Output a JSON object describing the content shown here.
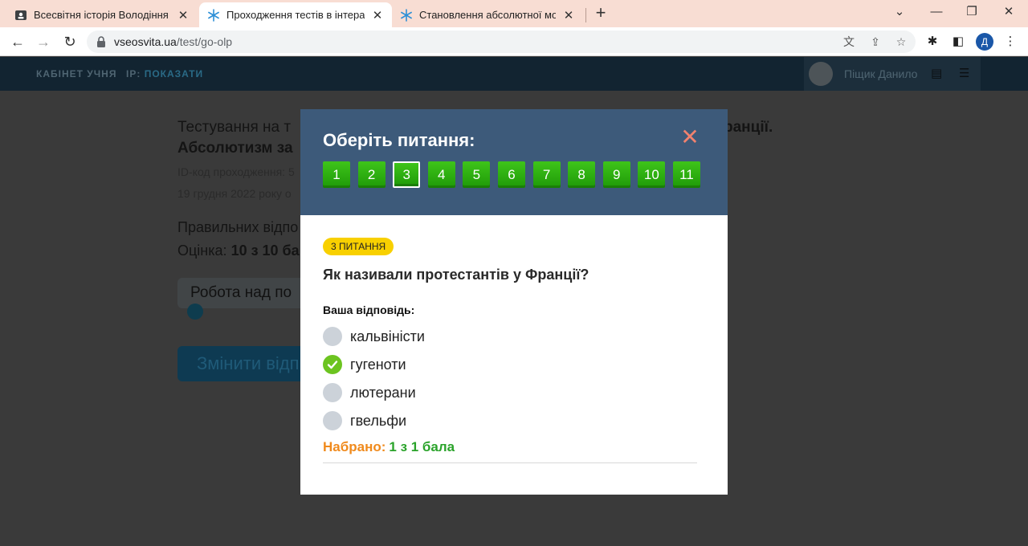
{
  "browser": {
    "tabs": [
      {
        "title": "Всесвітня історія Володіння Габ",
        "icon": "classroom-icon",
        "active": false
      },
      {
        "title": "Проходження тестів в інтеракти",
        "icon": "vseosvita-snowflake-icon",
        "active": true
      },
      {
        "title": "Становлення абсолютної монар",
        "icon": "vseosvita-snowflake-icon",
        "active": false
      }
    ],
    "new_tab": "+",
    "url_host": "vseosvita.ua",
    "url_path": "/test/go-olp",
    "profile_initial": "Д"
  },
  "site_header": {
    "cabinet": "КАБІНЕТ УЧНЯ",
    "ip_label": "IP:",
    "ip_value": "ПОКАЗАТИ",
    "user_name": "Піщик Данило"
  },
  "background_page": {
    "title_line1_start": "Тестування на т",
    "title_line1_end": "ранції.",
    "title_line2": "Абсолютизм за",
    "id_code": "ID-код проходження: 5",
    "date": "19 грудня 2022 року о",
    "correct_answers": "Правильних відпо",
    "grade_label": "Оцінка:",
    "grade_value": "10 з 10 ба",
    "work_button": "Робота над по",
    "change_button": "Змінити відп"
  },
  "modal": {
    "title": "Оберіть питання:",
    "close_symbol": "✕",
    "question_numbers": [
      "1",
      "2",
      "3",
      "4",
      "5",
      "6",
      "7",
      "8",
      "9",
      "10",
      "11"
    ],
    "current_question": "3",
    "badge": "3 ПИТАННЯ",
    "question": "Як називали протестантів у Франції?",
    "answer_label": "Ваша відповідь:",
    "options": [
      {
        "label": "кальвіністи",
        "checked": false
      },
      {
        "label": "гугеноти",
        "checked": true
      },
      {
        "label": "лютерани",
        "checked": false
      },
      {
        "label": "гвельфи",
        "checked": false
      }
    ],
    "score_label": "Набрано:",
    "score_value": "1 з 1 бала"
  },
  "colors": {
    "modal_header": "#3d5a7a",
    "question_button": "#2eb013",
    "close": "#f2826e",
    "badge": "#f8d000",
    "score_label": "#f08a1c",
    "score_value": "#2aa32a"
  }
}
